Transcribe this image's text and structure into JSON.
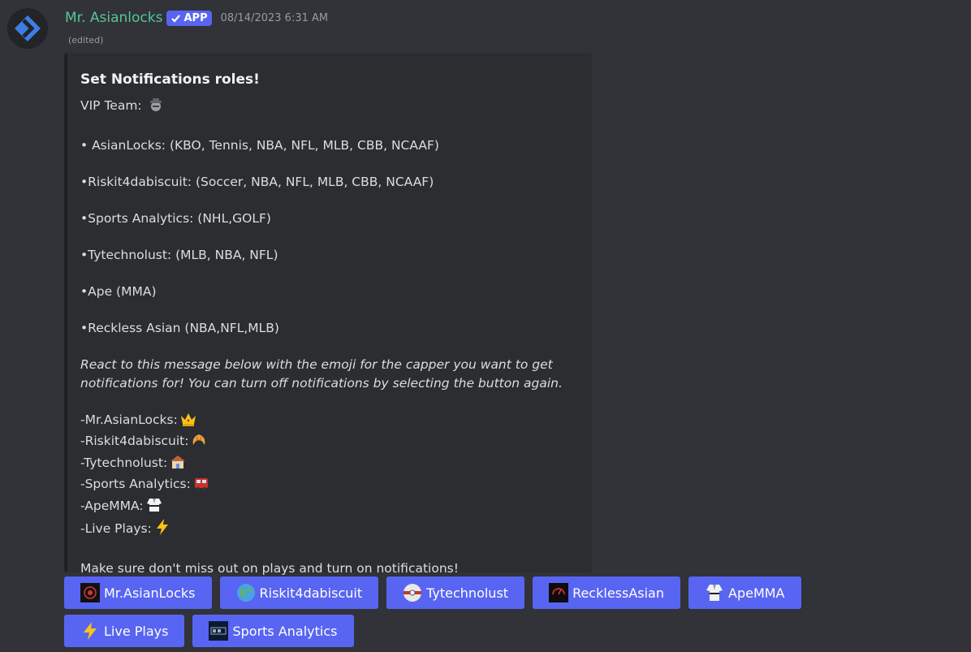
{
  "author": {
    "name": "Mr. Asianlocks",
    "tag": "APP",
    "timestamp": "08/14/2023 6:31 AM",
    "edited": "(edited)"
  },
  "embed": {
    "title": "Set Notifications roles!",
    "vip_team": "VIP Team:",
    "cappers": [
      "• AsianLocks: (KBO, Tennis, NBA, NFL, MLB, CBB, NCAAF)",
      "•Riskit4dabiscuit: (Soccer, NBA, NFL, MLB, CBB, NCAAF)",
      "•Sports Analytics: (NHL,GOLF)",
      "•Tytechnolust: (MLB, NBA, NFL)",
      "•Ape (MMA)",
      "•Reckless Asian (NBA,NFL,MLB)"
    ],
    "instruction_1": "React to this message below with the emoji for the capper you want to get",
    "instruction_2": "notifications for! You can turn off notifications by selecting the button again.",
    "reactions": [
      {
        "label": "-Mr.AsianLocks:",
        "icon": "crown-emoji"
      },
      {
        "label": "-Riskit4dabiscuit:",
        "icon": "croissant-emoji"
      },
      {
        "label": "-Tytechnolust:",
        "icon": "house-emoji"
      },
      {
        "label": "-Sports Analytics:",
        "icon": "train-emoji"
      },
      {
        "label": "-ApeMMA:",
        "icon": "martial-arts-uniform-emoji"
      },
      {
        "label": "-Live Plays:",
        "icon": "lightning-emoji"
      }
    ],
    "footer": "Make sure don't miss out on plays and turn on notifications!"
  },
  "buttons": [
    {
      "label": "Mr.AsianLocks",
      "icon": "asianlocks-logo-icon"
    },
    {
      "label": "Riskit4dabiscuit",
      "icon": "globe-icon"
    },
    {
      "label": "Tytechnolust",
      "icon": "tytechnolust-logo-icon"
    },
    {
      "label": "RecklessAsian",
      "icon": "recklessasian-logo-icon"
    },
    {
      "label": "ApeMMA",
      "icon": "martial-arts-uniform-icon"
    },
    {
      "label": "Live Plays",
      "icon": "lightning-icon"
    },
    {
      "label": "Sports Analytics",
      "icon": "sports-analytics-logo-icon"
    }
  ],
  "colors": {
    "background": "#313338",
    "embed_bg": "#2b2d31",
    "username": "#55c69a",
    "button": "#5865f2"
  }
}
